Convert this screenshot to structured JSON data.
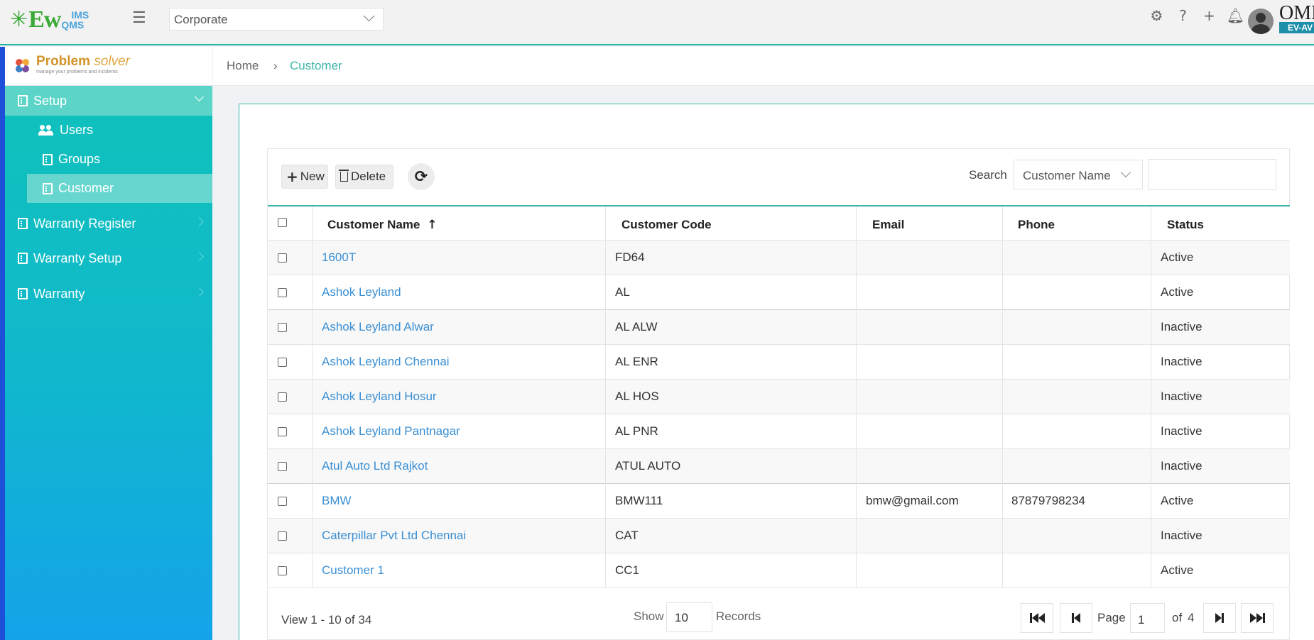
{
  "header": {
    "logo_main": "Ew",
    "logo_sub_top": "IMS",
    "logo_sub_bottom": "QMS",
    "org_select_value": "Corporate",
    "brand_name": "OMN",
    "brand_tag": "EV-AV",
    "icons": [
      "gear-icon",
      "help-icon",
      "plus-icon",
      "bell-icon",
      "avatar"
    ]
  },
  "sidebar": {
    "product_name": "Problem",
    "product_name_italic": "solver",
    "product_tagline": "manage your problems and incidents",
    "items": [
      {
        "label": "Setup",
        "expanded": true
      },
      {
        "label": "Users"
      },
      {
        "label": "Groups"
      },
      {
        "label": "Customer",
        "active": true
      },
      {
        "label": "Warranty Register"
      },
      {
        "label": "Warranty Setup"
      },
      {
        "label": "Warranty"
      }
    ]
  },
  "breadcrumb": {
    "home": "Home",
    "separator": "›",
    "current": "Customer"
  },
  "toolbar": {
    "new_label": "New",
    "delete_label": "Delete",
    "search_label": "Search",
    "search_field": "Customer Name",
    "search_value": ""
  },
  "table": {
    "columns": [
      "Customer Name",
      "Customer Code",
      "Email",
      "Phone",
      "Status"
    ],
    "sort_column": "Customer Name",
    "rows": [
      {
        "name": "1600T",
        "code": "FD64",
        "email": "",
        "phone": "",
        "status": "Active"
      },
      {
        "name": "Ashok Leyland",
        "code": "AL",
        "email": "",
        "phone": "",
        "status": "Active"
      },
      {
        "name": "Ashok Leyland Alwar",
        "code": "AL ALW",
        "email": "",
        "phone": "",
        "status": "Inactive"
      },
      {
        "name": "Ashok Leyland Chennai",
        "code": "AL ENR",
        "email": "",
        "phone": "",
        "status": "Inactive"
      },
      {
        "name": "Ashok Leyland Hosur",
        "code": "AL HOS",
        "email": "",
        "phone": "",
        "status": "Inactive"
      },
      {
        "name": "Ashok Leyland Pantnagar",
        "code": "AL PNR",
        "email": "",
        "phone": "",
        "status": "Inactive"
      },
      {
        "name": "Atul Auto Ltd Rajkot",
        "code": "ATUL AUTO",
        "email": "",
        "phone": "",
        "status": "Inactive"
      },
      {
        "name": "BMW",
        "code": "BMW111",
        "email": "bmw@gmail.com",
        "phone": "87879798234",
        "status": "Active"
      },
      {
        "name": "Caterpillar Pvt Ltd Chennai",
        "code": "CAT",
        "email": "",
        "phone": "",
        "status": "Inactive"
      },
      {
        "name": "Customer 1",
        "code": "CC1",
        "email": "",
        "phone": "",
        "status": "Active"
      }
    ]
  },
  "pager": {
    "view_text": "View 1 - 10 of 34",
    "show_label": "Show",
    "page_size": "10",
    "records_label": "Records",
    "page_label": "Page",
    "current_page": "1",
    "of_label": "of",
    "total_pages": "4"
  },
  "colors": {
    "accent": "#3ab5a8",
    "link": "#3a8fd3",
    "sidebar_top": "#0fc3b9",
    "sidebar_bottom": "#14a3ea"
  }
}
